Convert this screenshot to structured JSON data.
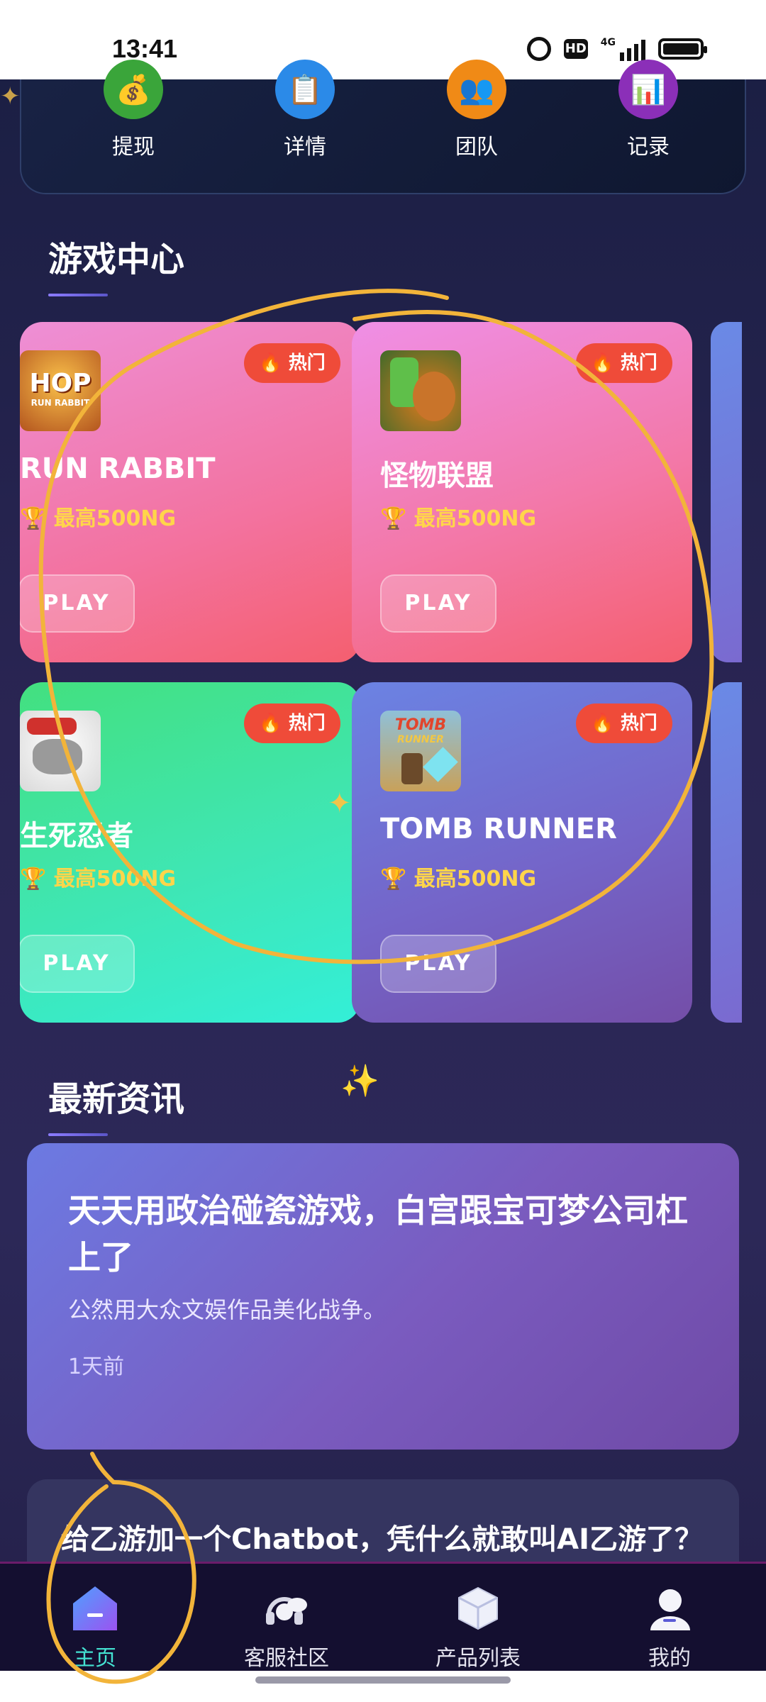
{
  "status_bar": {
    "time": "13:41",
    "hd_label": "HD",
    "network_label": "4G"
  },
  "quick_actions": [
    {
      "label": "提现",
      "icon": "money-bag-icon",
      "color": "#3aa53a",
      "glyph": "💰"
    },
    {
      "label": "详情",
      "icon": "clipboard-icon",
      "color": "#2b8ae8",
      "glyph": "📋"
    },
    {
      "label": "团队",
      "icon": "team-icon",
      "color": "#f08a16",
      "glyph": "👥"
    },
    {
      "label": "记录",
      "icon": "chart-icon",
      "color": "#8b2fb8",
      "glyph": "📊"
    }
  ],
  "game_center": {
    "title": "游戏中心",
    "cards": [
      {
        "name": "RUN RABBIT",
        "reward": "🏆 最高500NG",
        "play": "PLAY",
        "hot": "🔥 热门",
        "thumb_text": "HOP",
        "thumb_sub": "RUN RABBIT"
      },
      {
        "name": "怪物联盟",
        "reward": "🏆 最高500NG",
        "play": "PLAY",
        "hot": "🔥 热门"
      },
      {
        "name": "生死忍者",
        "reward": "🏆 最高500NG",
        "play": "PLAY",
        "hot": "🔥 热门"
      },
      {
        "name": "TOMB RUNNER",
        "reward": "🏆 最高500NG",
        "play": "PLAY",
        "hot": "🔥 热门",
        "thumb_text": "TOMB",
        "thumb_sub": "RUNNER"
      }
    ]
  },
  "news": {
    "title": "最新资讯",
    "items": [
      {
        "title": "天天用政治碰瓷游戏，白宫跟宝可梦公司杠上了",
        "summary": "公然用大众文娱作品美化战争。",
        "time": "1天前"
      },
      {
        "title": "给乙游加一个Chatbot，凭什么就敢叫AI乙游了？"
      }
    ]
  },
  "tabbar": [
    {
      "label": "主页",
      "icon": "home-icon",
      "active": true
    },
    {
      "label": "客服社区",
      "icon": "headset-icon",
      "active": false
    },
    {
      "label": "产品列表",
      "icon": "cube-icon",
      "active": false
    },
    {
      "label": "我的",
      "icon": "profile-icon",
      "active": false
    }
  ]
}
